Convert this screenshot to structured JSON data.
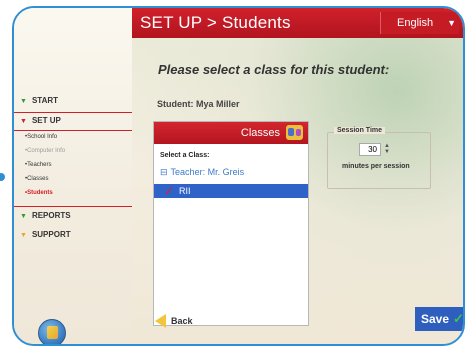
{
  "header": {
    "title": "SET UP > Students",
    "language": "English"
  },
  "sidebar": {
    "start": "START",
    "setup": "SET UP",
    "setup_items": [
      "•School Info",
      "•Computer Info",
      "•Teachers",
      "•Classes",
      "•Students"
    ],
    "reports": "REPORTS",
    "support": "SUPPORT"
  },
  "main": {
    "prompt": "Please select a class for this student:",
    "student_label": "Student: Mya Miller",
    "classes": {
      "title": "Classes",
      "select_label": "Select a Class:",
      "teacher": "Teacher: Mr. Greis",
      "teacher_expander": "⊟",
      "selected_class": "RII"
    },
    "session": {
      "legend": "Session Time",
      "value": "30",
      "suffix": "minutes per session"
    },
    "back_label": "Back",
    "save_label": "Save"
  },
  "colors": {
    "accent_red": "#d0212c",
    "accent_blue": "#2f63c7",
    "frame_blue": "#2f8fd4"
  },
  "icons": {
    "back": "back-arrow-icon",
    "check": "check-icon",
    "classes": "classes-icon",
    "home": "home-icon"
  }
}
